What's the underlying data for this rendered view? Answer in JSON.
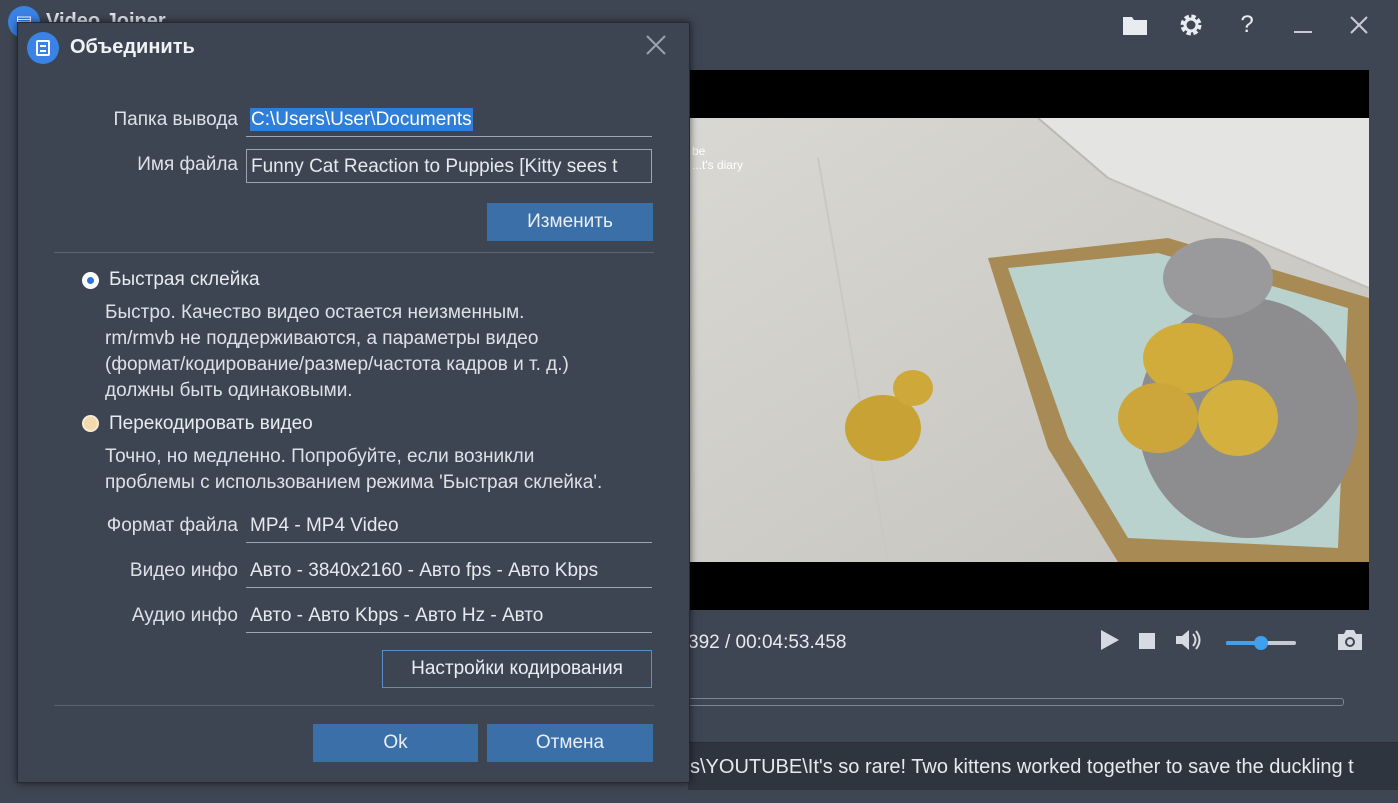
{
  "app": {
    "title": "Video Joiner",
    "logo_glyph": "▤",
    "time_display": "392 / 00:04:53.458",
    "video_overlay_lines": [
      "be",
      "...t's diary"
    ],
    "path_text": "s\\YOUTUBE\\It's so rare! Two kittens worked together to save the duckling t",
    "volume_level": 0.5
  },
  "dialog": {
    "title": "Объединить",
    "output_folder": {
      "label": "Папка вывода",
      "value": "C:\\Users\\User\\Documents"
    },
    "file_name": {
      "label": "Имя файла",
      "value": "Funny Cat Reaction to Puppies [Kitty sees t"
    },
    "change_button": "Изменить",
    "fast_join": {
      "label": "Быстрая склейка",
      "desc": [
        "Быстро. Качество видео остается неизменным.",
        "rm/rmvb не поддерживаются, а параметры видео",
        "(формат/кодирование/размер/частота кадров и т. д.)",
        "должны быть одинаковыми."
      ]
    },
    "reencode": {
      "label": "Перекодировать видео",
      "desc": [
        "Точно, но медленно. Попробуйте, если возникли",
        "проблемы с использованием режима 'Быстрая склейка'."
      ]
    },
    "file_format": {
      "label": "Формат файла",
      "value": "MP4 - MP4 Video"
    },
    "video_info": {
      "label": "Видео инфо",
      "value": "Авто - 3840x2160 - Авто fps - Авто Kbps"
    },
    "audio_info": {
      "label": "Аудио инфо",
      "value": "Авто - Авто Kbps - Авто Hz - Авто"
    },
    "encode_settings_button": "Настройки кодирования",
    "ok_button": "Ok",
    "cancel_button": "Отмена"
  },
  "colors": {
    "accent": "#3b82e6",
    "button": "#3a6fa8",
    "background": "#3e4552"
  }
}
